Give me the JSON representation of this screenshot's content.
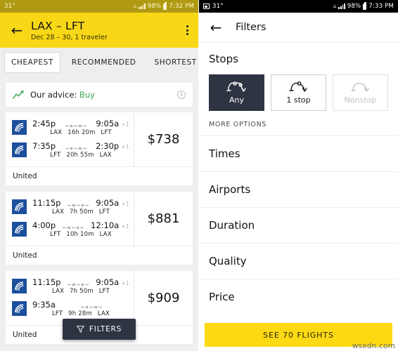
{
  "left": {
    "statusbar": {
      "temp": "31°",
      "battery": "98%",
      "time": "7:32 PM"
    },
    "appbar": {
      "title": "LAX – LFT",
      "subtitle": "Dec 28 – 30, 1 traveler",
      "back_icon": "back-arrow-icon",
      "menu_icon": "overflow-menu-icon"
    },
    "tabs": [
      {
        "label": "CHEAPEST",
        "selected": true
      },
      {
        "label": "RECOMMENDED",
        "selected": false
      },
      {
        "label": "SHORTEST",
        "selected": false
      }
    ],
    "advice": {
      "prefix": "Our advice: ",
      "value": "Buy",
      "icon": "trend-up-icon",
      "info_icon": "info-icon"
    },
    "flights": [
      {
        "price": "$738",
        "airline": "United",
        "legs": [
          {
            "depart": "2:45p",
            "arrive": "9:05a",
            "plus": "+1",
            "origin": "LAX",
            "duration": "16h 20m",
            "destination": "LFT"
          },
          {
            "depart": "7:35p",
            "arrive": "2:30p",
            "plus": "+1",
            "origin": "LFT",
            "duration": "20h 55m",
            "destination": "LAX"
          }
        ]
      },
      {
        "price": "$881",
        "airline": "United",
        "legs": [
          {
            "depart": "11:15p",
            "arrive": "9:05a",
            "plus": "+1",
            "origin": "LAX",
            "duration": "7h 50m",
            "destination": "LFT"
          },
          {
            "depart": "4:00p",
            "arrive": "12:10a",
            "plus": "+1",
            "origin": "LFT",
            "duration": "10h 10m",
            "destination": "LAX"
          }
        ]
      },
      {
        "price": "$909",
        "airline": "United",
        "legs": [
          {
            "depart": "11:15p",
            "arrive": "9:05a",
            "plus": "+1",
            "origin": "LAX",
            "duration": "7h 50m",
            "destination": "LFT"
          },
          {
            "depart": "9:35a",
            "arrive": "",
            "plus": "",
            "origin": "LFT",
            "duration": "9h 28m",
            "destination": "LAX"
          }
        ]
      }
    ],
    "filters_button": {
      "label": "FILTERS",
      "icon": "funnel-icon"
    }
  },
  "right": {
    "statusbar": {
      "temp": "31°",
      "battery": "98%",
      "time": "7:33 PM",
      "shot_icon": "screenshot-icon"
    },
    "appbar": {
      "title": "Filters",
      "back_icon": "back-arrow-icon"
    },
    "stops": {
      "heading": "Stops",
      "options": [
        {
          "label": "Any",
          "state": "selected"
        },
        {
          "label": "1 stop",
          "state": "normal"
        },
        {
          "label": "Nonstop",
          "state": "disabled"
        }
      ],
      "more_options": "MORE OPTIONS"
    },
    "sections": [
      {
        "label": "Times"
      },
      {
        "label": "Airports"
      },
      {
        "label": "Duration"
      },
      {
        "label": "Quality"
      },
      {
        "label": "Price"
      }
    ],
    "cta": {
      "label": "SEE 70 FLIGHTS"
    },
    "watermark": "wsxdn.com"
  },
  "colors": {
    "yellow": "#f7d716",
    "cta_yellow": "#fcd913",
    "dark_navy": "#2e3442",
    "green": "#3faa55",
    "united_blue": "#1c4f9c"
  }
}
